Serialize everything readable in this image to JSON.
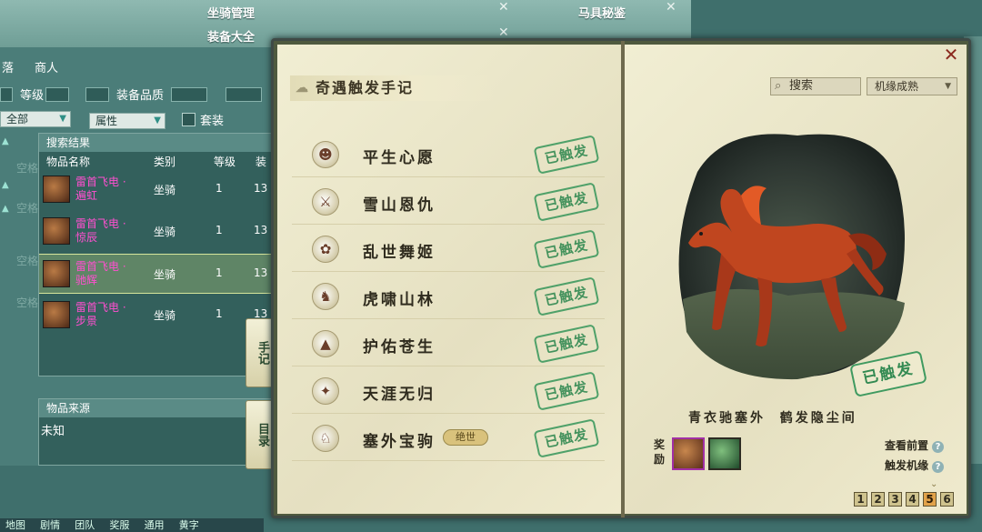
{
  "background": {
    "top_tabs": [
      "坐骑管理",
      "马具秘鉴",
      "装备大全"
    ],
    "filters": {
      "tabs": [
        "落",
        "商人"
      ],
      "level_label": "等级",
      "quality_label": "装备品质",
      "all_select": "全部",
      "attr_select": "属性",
      "set_label": "套装"
    },
    "results": {
      "title": "搜索结果",
      "columns": [
        "物品名称",
        "类别",
        "等级",
        "装"
      ],
      "rows": [
        {
          "name": "雷首飞电 · 遍虹",
          "type": "坐骑",
          "level": "1",
          "extra": "13"
        },
        {
          "name": "雷首飞电 · 惊辰",
          "type": "坐骑",
          "level": "1",
          "extra": "13"
        },
        {
          "name": "雷首飞电 · 驰辉",
          "type": "坐骑",
          "level": "1",
          "extra": "13"
        },
        {
          "name": "雷首飞电 · 步景",
          "type": "坐骑",
          "level": "1",
          "extra": "13"
        }
      ]
    },
    "source": {
      "title": "物品来源",
      "value": "未知"
    },
    "side_tabs": [
      "手记",
      "目录"
    ],
    "bottom_tabs": [
      "地图",
      "剧情",
      "团队",
      "奖服",
      "通用",
      "黄字"
    ],
    "ghost_labels": [
      "空格",
      "空格",
      "空格",
      "空格"
    ]
  },
  "book": {
    "title": "奇遇触发手记",
    "search_placeholder": "搜索",
    "filter_value": "机缘成熟",
    "entries": [
      {
        "title": "平生心愿",
        "icon": "☻",
        "badge": "",
        "status": "已触发"
      },
      {
        "title": "雪山恩仇",
        "icon": "⚔",
        "badge": "",
        "status": "已触发"
      },
      {
        "title": "乱世舞姬",
        "icon": "✿",
        "badge": "",
        "status": "已触发"
      },
      {
        "title": "虎啸山林",
        "icon": "♞",
        "badge": "",
        "status": "已触发"
      },
      {
        "title": "护佑苍生",
        "icon": "▲",
        "badge": "",
        "status": "已触发"
      },
      {
        "title": "天涯无归",
        "icon": "✦",
        "badge": "",
        "status": "已触发"
      },
      {
        "title": "塞外宝驹",
        "icon": "♘",
        "badge": "绝世",
        "status": "已触发"
      }
    ],
    "detail": {
      "status": "已触发",
      "poem": "青衣驰塞外  鹤发隐尘间",
      "reward_label": "奖励",
      "links": [
        "查看前置",
        "触发机缘"
      ],
      "pages": [
        "1",
        "2",
        "3",
        "4",
        "5",
        "6"
      ],
      "active_page": "5"
    }
  },
  "colors": {
    "stamp_green": "#338a52",
    "paper": "#efeacd",
    "item_pink": "#ff4fd0",
    "teal_bg": "#3f6f6c"
  }
}
